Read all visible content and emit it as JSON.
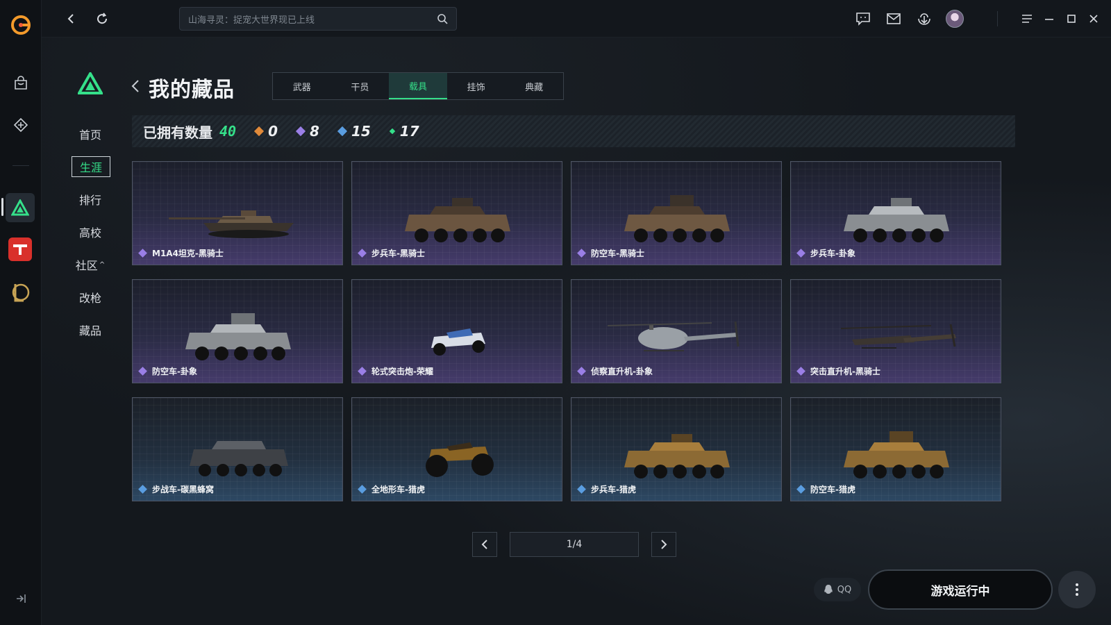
{
  "search": {
    "placeholder": "山海寻灵：捉宠大世界现已上线"
  },
  "rail": {
    "icons": [
      "app-logo-icon",
      "store-bag-icon",
      "game-tag-icon",
      "delta-force-app-icon",
      "tf-app-icon",
      "league-app-icon",
      "collapse-sidebar-icon"
    ]
  },
  "topbar": {
    "icons": [
      "back-icon",
      "refresh-icon",
      "search-icon",
      "chat-icon",
      "mail-icon",
      "download-icon",
      "avatar",
      "menu-icon",
      "minimize-icon",
      "maximize-icon",
      "close-icon"
    ]
  },
  "subnav": {
    "items": [
      {
        "label": "首页"
      },
      {
        "label": "生涯",
        "active": true
      },
      {
        "label": "排行"
      },
      {
        "label": "高校"
      },
      {
        "label": "社区",
        "caret": "^"
      },
      {
        "label": "改枪"
      },
      {
        "label": "藏品"
      }
    ]
  },
  "page": {
    "title": "我的藏品"
  },
  "tabs": [
    {
      "label": "武器"
    },
    {
      "label": "干员"
    },
    {
      "label": "载具",
      "active": true
    },
    {
      "label": "挂饰"
    },
    {
      "label": "典藏"
    }
  ],
  "stats": {
    "owned_label": "已拥有数量",
    "owned_total": "40",
    "counts": [
      {
        "value": "0",
        "color": "#e08a3a"
      },
      {
        "value": "8",
        "color": "#9a7fe6"
      },
      {
        "value": "15",
        "color": "#5a9de0"
      },
      {
        "value": "17",
        "color": "#35e08a"
      }
    ]
  },
  "items": [
    {
      "name": "M1A4坦克-黑骑士",
      "rarity": "purple",
      "vehicle": "tank"
    },
    {
      "name": "步兵车-黑骑士",
      "rarity": "purple",
      "vehicle": "apc"
    },
    {
      "name": "防空车-黑骑士",
      "rarity": "purple",
      "vehicle": "apc"
    },
    {
      "name": "步兵车-卦象",
      "rarity": "purple",
      "vehicle": "apc"
    },
    {
      "name": "防空车-卦象",
      "rarity": "purple",
      "vehicle": "apc"
    },
    {
      "name": "轮式突击炮-荣耀",
      "rarity": "purple",
      "vehicle": "buggy"
    },
    {
      "name": "侦察直升机-卦象",
      "rarity": "purple",
      "vehicle": "heli"
    },
    {
      "name": "突击直升机-黑骑士",
      "rarity": "purple",
      "vehicle": "attackheli"
    },
    {
      "name": "步战车-碳黑蜂窝",
      "rarity": "blue",
      "vehicle": "apc"
    },
    {
      "name": "全地形车-猎虎",
      "rarity": "blue",
      "vehicle": "atv"
    },
    {
      "name": "步兵车-猎虎",
      "rarity": "blue",
      "vehicle": "apc"
    },
    {
      "name": "防空车-猎虎",
      "rarity": "blue",
      "vehicle": "apc"
    }
  ],
  "rarity_colors": {
    "purple": "#9a7fe6",
    "blue": "#5a9de0"
  },
  "pagination": {
    "indicator": "1/4",
    "current_page": 1,
    "total_pages": 4
  },
  "bottom": {
    "qq_label": "QQ",
    "launch_label": "游戏运行中"
  },
  "accent_color": "#35e08a"
}
